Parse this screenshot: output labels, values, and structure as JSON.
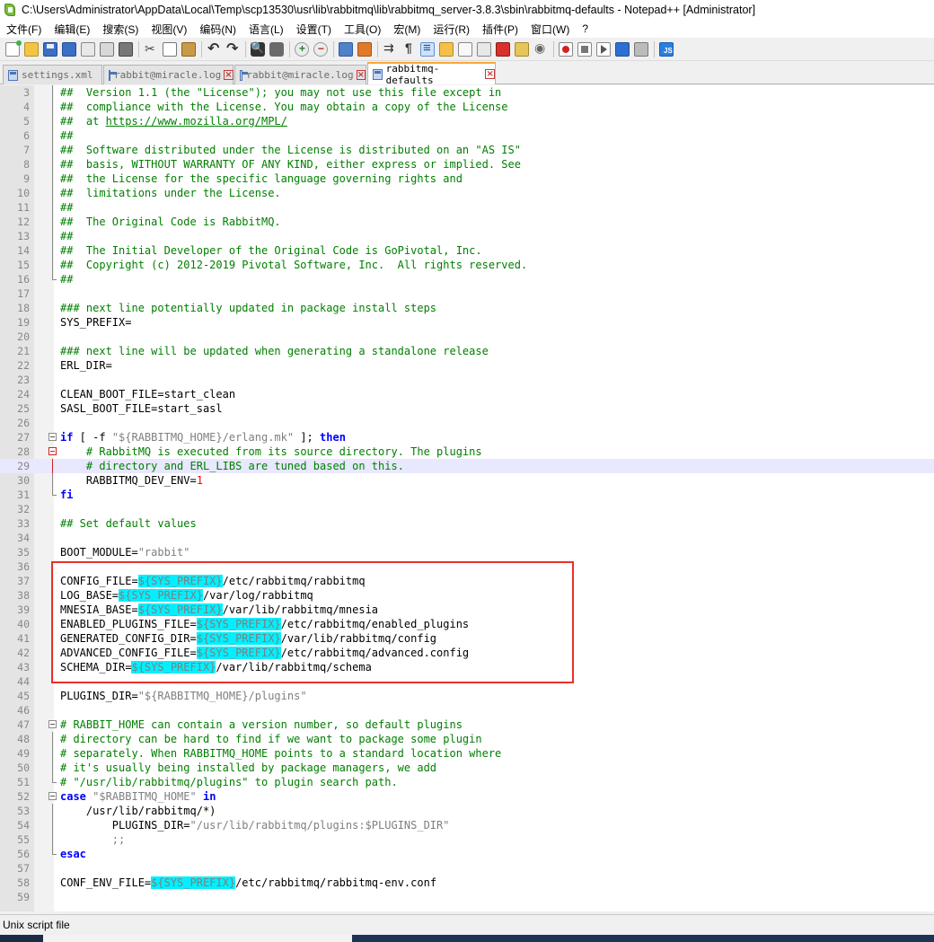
{
  "window": {
    "title": "C:\\Users\\Administrator\\AppData\\Local\\Temp\\scp13530\\usr\\lib\\rabbitmq\\lib\\rabbitmq_server-3.8.3\\sbin\\rabbitmq-defaults - Notepad++ [Administrator]"
  },
  "menu": [
    "文件(F)",
    "编辑(E)",
    "搜索(S)",
    "视图(V)",
    "编码(N)",
    "语言(L)",
    "设置(T)",
    "工具(O)",
    "宏(M)",
    "运行(R)",
    "插件(P)",
    "窗口(W)",
    "?"
  ],
  "tabs": [
    {
      "label": "settings.xml",
      "active": false
    },
    {
      "label": "rabbit@miracle.log",
      "active": false
    },
    {
      "label": "rabbit@miracle.log",
      "active": false
    },
    {
      "label": "rabbitmq-defaults",
      "active": true
    }
  ],
  "editor": {
    "current_line": 29,
    "highlight_range": [
      37,
      43
    ],
    "lines": [
      {
        "n": 3,
        "t": [
          [
            "c",
            "##  Version 1.1 (the \"License\"); you may not use this file except in"
          ]
        ]
      },
      {
        "n": 4,
        "t": [
          [
            "c",
            "##  compliance with the License. You may obtain a copy of the License"
          ]
        ]
      },
      {
        "n": 5,
        "t": [
          [
            "c",
            "##  at "
          ],
          [
            "u",
            "https://www.mozilla.org/MPL/"
          ]
        ]
      },
      {
        "n": 6,
        "t": [
          [
            "c",
            "##"
          ]
        ]
      },
      {
        "n": 7,
        "t": [
          [
            "c",
            "##  Software distributed under the License is distributed on an \"AS IS\""
          ]
        ]
      },
      {
        "n": 8,
        "t": [
          [
            "c",
            "##  basis, WITHOUT WARRANTY OF ANY KIND, either express or implied. See"
          ]
        ]
      },
      {
        "n": 9,
        "t": [
          [
            "c",
            "##  the License for the specific language governing rights and"
          ]
        ]
      },
      {
        "n": 10,
        "t": [
          [
            "c",
            "##  limitations under the License."
          ]
        ]
      },
      {
        "n": 11,
        "t": [
          [
            "c",
            "##"
          ]
        ]
      },
      {
        "n": 12,
        "t": [
          [
            "c",
            "##  The Original Code is RabbitMQ."
          ]
        ]
      },
      {
        "n": 13,
        "t": [
          [
            "c",
            "##"
          ]
        ]
      },
      {
        "n": 14,
        "t": [
          [
            "c",
            "##  The Initial Developer of the Original Code is GoPivotal, Inc."
          ]
        ]
      },
      {
        "n": 15,
        "t": [
          [
            "c",
            "##  Copyright (c) 2012-2019 Pivotal Software, Inc.  All rights reserved."
          ]
        ]
      },
      {
        "n": 16,
        "t": [
          [
            "c",
            "##"
          ]
        ]
      },
      {
        "n": 17,
        "t": []
      },
      {
        "n": 18,
        "t": [
          [
            "c",
            "### next line potentially updated in package install steps"
          ]
        ]
      },
      {
        "n": 19,
        "t": [
          [
            "p",
            "SYS_PREFIX="
          ]
        ]
      },
      {
        "n": 20,
        "t": []
      },
      {
        "n": 21,
        "t": [
          [
            "c",
            "### next line will be updated when generating a standalone release"
          ]
        ]
      },
      {
        "n": 22,
        "t": [
          [
            "p",
            "ERL_DIR="
          ]
        ]
      },
      {
        "n": 23,
        "t": []
      },
      {
        "n": 24,
        "t": [
          [
            "p",
            "CLEAN_BOOT_FILE=start_clean"
          ]
        ]
      },
      {
        "n": 25,
        "t": [
          [
            "p",
            "SASL_BOOT_FILE=start_sasl"
          ]
        ]
      },
      {
        "n": 26,
        "t": []
      },
      {
        "n": 27,
        "t": [
          [
            "k",
            "if"
          ],
          [
            "p",
            " [ -f "
          ],
          [
            "s",
            "\"${RABBITMQ_HOME}/erlang.mk\""
          ],
          [
            "p",
            " ]; "
          ],
          [
            "k",
            "then"
          ]
        ]
      },
      {
        "n": 28,
        "t": [
          [
            "p",
            "    "
          ],
          [
            "c",
            "# RabbitMQ is executed from its source directory. The plugins"
          ]
        ]
      },
      {
        "n": 29,
        "t": [
          [
            "p",
            "    "
          ],
          [
            "c",
            "# directory and ERL_LIBS are tuned based on this."
          ]
        ]
      },
      {
        "n": 30,
        "t": [
          [
            "p",
            "    RABBITMQ_DEV_ENV="
          ],
          [
            "n",
            "1"
          ]
        ]
      },
      {
        "n": 31,
        "t": [
          [
            "k",
            "fi"
          ]
        ]
      },
      {
        "n": 32,
        "t": []
      },
      {
        "n": 33,
        "t": [
          [
            "c",
            "## Set default values"
          ]
        ]
      },
      {
        "n": 34,
        "t": []
      },
      {
        "n": 35,
        "t": [
          [
            "p",
            "BOOT_MODULE="
          ],
          [
            "s",
            "\"rabbit\""
          ]
        ]
      },
      {
        "n": 36,
        "t": []
      },
      {
        "n": 37,
        "t": [
          [
            "p",
            "CONFIG_FILE="
          ],
          [
            "v",
            "${SYS_PREFIX}"
          ],
          [
            "p",
            "/etc/rabbitmq/rabbitmq"
          ]
        ]
      },
      {
        "n": 38,
        "t": [
          [
            "p",
            "LOG_BASE="
          ],
          [
            "v",
            "${SYS_PREFIX}"
          ],
          [
            "p",
            "/var/log/rabbitmq"
          ]
        ]
      },
      {
        "n": 39,
        "t": [
          [
            "p",
            "MNESIA_BASE="
          ],
          [
            "v",
            "${SYS_PREFIX}"
          ],
          [
            "p",
            "/var/lib/rabbitmq/mnesia"
          ]
        ]
      },
      {
        "n": 40,
        "t": [
          [
            "p",
            "ENABLED_PLUGINS_FILE="
          ],
          [
            "v",
            "${SYS_PREFIX}"
          ],
          [
            "p",
            "/etc/rabbitmq/enabled_plugins"
          ]
        ]
      },
      {
        "n": 41,
        "t": [
          [
            "p",
            "GENERATED_CONFIG_DIR="
          ],
          [
            "v",
            "${SYS_PREFIX}"
          ],
          [
            "p",
            "/var/lib/rabbitmq/config"
          ]
        ]
      },
      {
        "n": 42,
        "t": [
          [
            "p",
            "ADVANCED_CONFIG_FILE="
          ],
          [
            "v",
            "${SYS_PREFIX}"
          ],
          [
            "p",
            "/etc/rabbitmq/advanced.config"
          ]
        ]
      },
      {
        "n": 43,
        "t": [
          [
            "p",
            "SCHEMA_DIR="
          ],
          [
            "v",
            "${SYS_PREFIX}"
          ],
          [
            "p",
            "/var/lib/rabbitmq/schema"
          ]
        ]
      },
      {
        "n": 44,
        "t": []
      },
      {
        "n": 45,
        "t": [
          [
            "p",
            "PLUGINS_DIR="
          ],
          [
            "s",
            "\"${RABBITMQ_HOME}/plugins\""
          ]
        ]
      },
      {
        "n": 46,
        "t": []
      },
      {
        "n": 47,
        "t": [
          [
            "c",
            "# RABBIT_HOME can contain a version number, so default plugins"
          ]
        ]
      },
      {
        "n": 48,
        "t": [
          [
            "c",
            "# directory can be hard to find if we want to package some plugin"
          ]
        ]
      },
      {
        "n": 49,
        "t": [
          [
            "c",
            "# separately. When RABBITMQ_HOME points to a standard location where"
          ]
        ]
      },
      {
        "n": 50,
        "t": [
          [
            "c",
            "# it's usually being installed by package managers, we add"
          ]
        ]
      },
      {
        "n": 51,
        "t": [
          [
            "c",
            "# \"/usr/lib/rabbitmq/plugins\" to plugin search path."
          ]
        ]
      },
      {
        "n": 52,
        "t": [
          [
            "k",
            "case"
          ],
          [
            "p",
            " "
          ],
          [
            "s",
            "\"$RABBITMQ_HOME\""
          ],
          [
            "p",
            " "
          ],
          [
            "k",
            "in"
          ]
        ]
      },
      {
        "n": 53,
        "t": [
          [
            "p",
            "    /usr/lib/rabbitmq/*)"
          ]
        ]
      },
      {
        "n": 54,
        "t": [
          [
            "p",
            "        PLUGINS_DIR="
          ],
          [
            "s",
            "\"/usr/lib/rabbitmq/plugins:$PLUGINS_DIR\""
          ]
        ]
      },
      {
        "n": 55,
        "t": [
          [
            "p",
            "        "
          ],
          [
            "s",
            ";;"
          ]
        ]
      },
      {
        "n": 56,
        "t": [
          [
            "k",
            "esac"
          ]
        ]
      },
      {
        "n": 57,
        "t": []
      },
      {
        "n": 58,
        "t": [
          [
            "p",
            "CONF_ENV_FILE="
          ],
          [
            "v",
            "${SYS_PREFIX}"
          ],
          [
            "p",
            "/etc/rabbitmq/rabbitmq-env.conf"
          ]
        ]
      },
      {
        "n": 59,
        "t": []
      }
    ]
  },
  "status": {
    "file_type": "Unix script file"
  }
}
